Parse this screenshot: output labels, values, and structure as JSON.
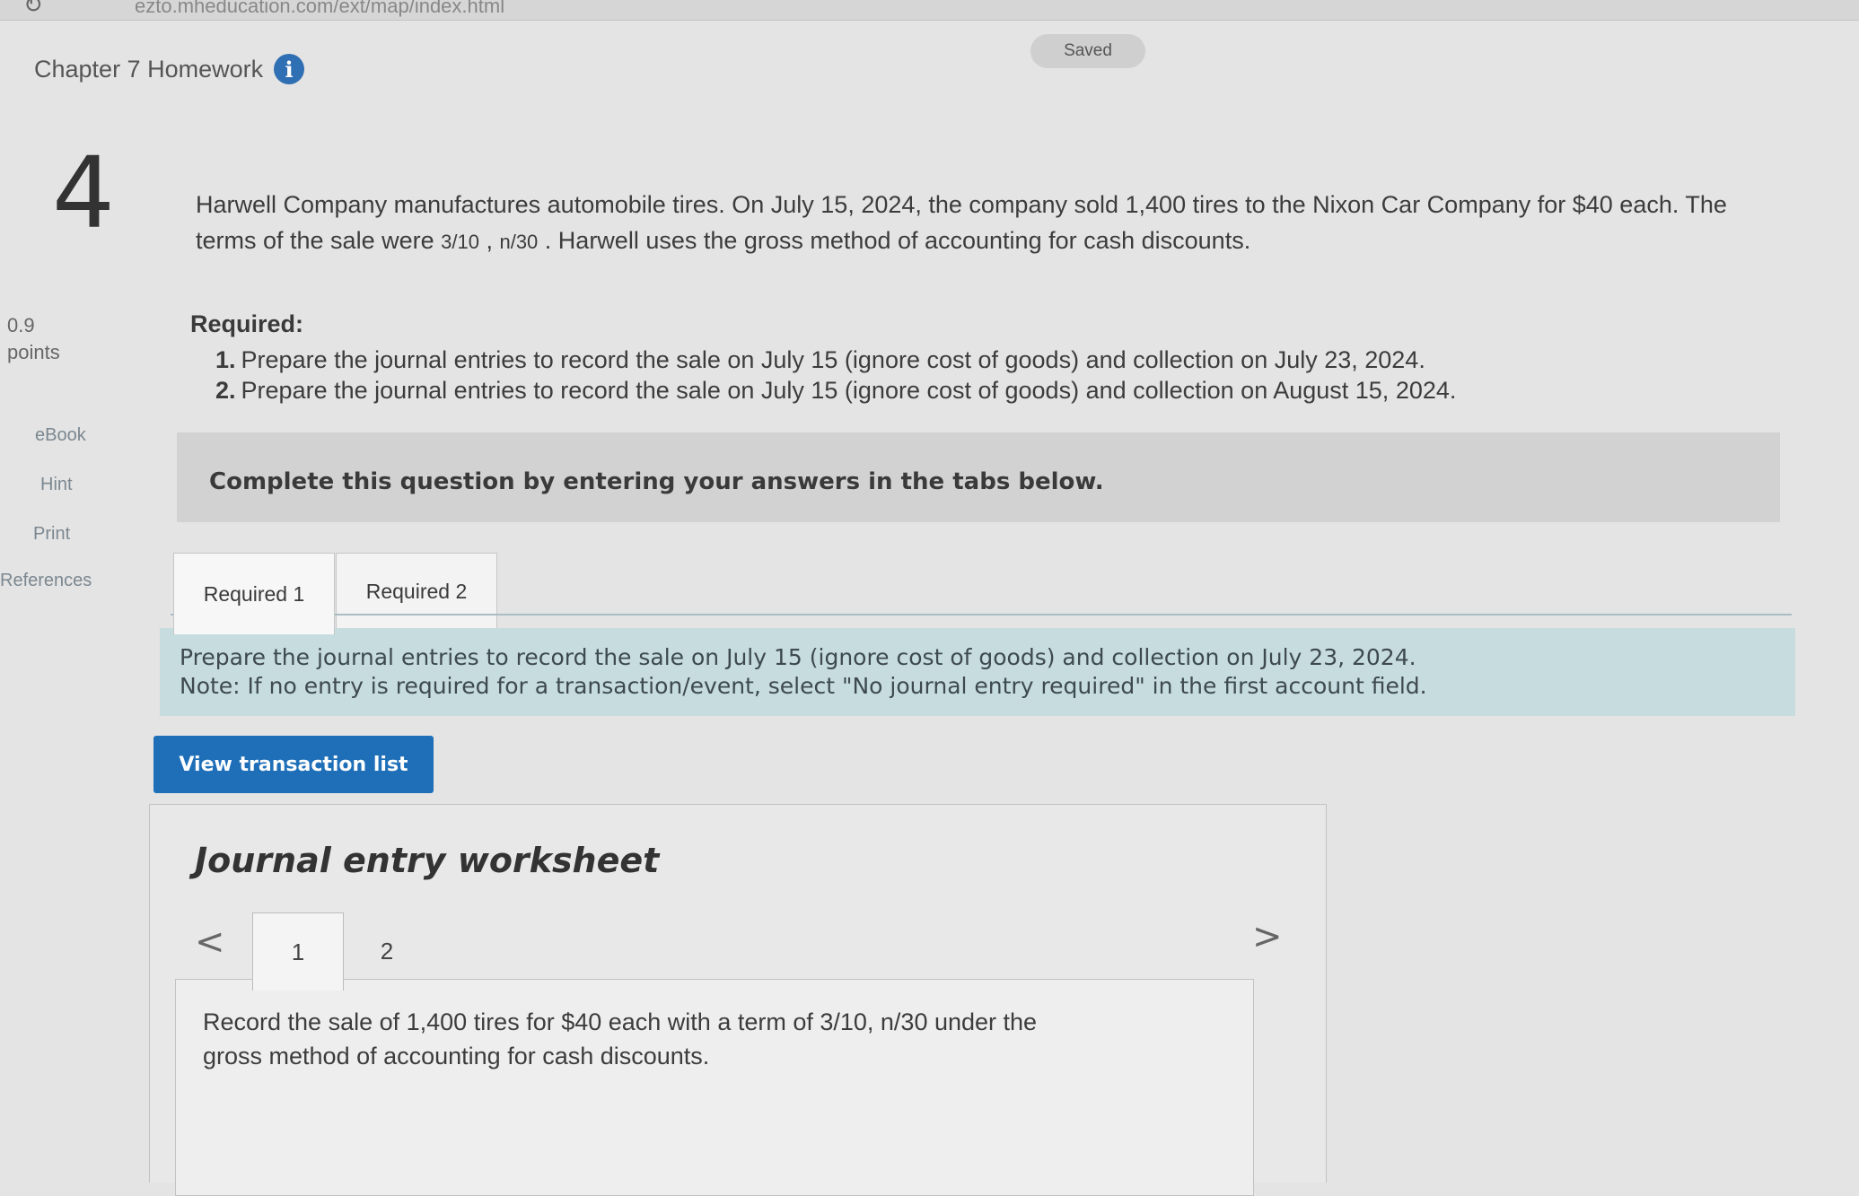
{
  "browser": {
    "url": "ezto.mheducation.com/ext/map/index.html"
  },
  "assignment": {
    "title": "Chapter 7 Homework",
    "saved_label": "Saved"
  },
  "question": {
    "number": "4",
    "points_value": "0.9",
    "points_label": "points",
    "side_links": [
      "eBook",
      "Hint",
      "Print",
      "References"
    ],
    "problem_part1": "Harwell Company manufactures automobile tires. On July 15, 2024, the company sold 1,400 tires to the Nixon Car Company for $40 each. The terms of the sale were ",
    "term1": "3/10",
    "term_sep": " , ",
    "term2": "n/30",
    "problem_part2": " . Harwell uses the gross method of accounting for cash discounts.",
    "required_heading": "Required:",
    "requirements": [
      {
        "num": "1.",
        "text": "Prepare the journal entries to record the sale on July 15 (ignore cost of goods) and collection on July 23, 2024."
      },
      {
        "num": "2.",
        "text": "Prepare the journal entries to record the sale on July 15 (ignore cost of goods) and collection on August 15, 2024."
      }
    ],
    "complete_banner": "Complete this question by entering your answers in the tabs below."
  },
  "tabs": [
    {
      "label": "Required 1"
    },
    {
      "label": "Required 2"
    }
  ],
  "instructions": {
    "line1": "Prepare the journal entries to record the sale on July 15 (ignore cost of goods) and collection on July 23, 2024.",
    "line2": "Note: If no entry is required for a transaction/event, select \"No journal entry required\" in the first account field."
  },
  "view_transaction_button": "View transaction list",
  "worksheet": {
    "title": "Journal entry worksheet",
    "prev_symbol": "<",
    "next_symbol": ">",
    "entry_tabs": [
      "1",
      "2"
    ],
    "entry_description": "Record the sale of 1,400 tires for $40 each with a term of 3/10, n/30 under the gross method of accounting for cash discounts."
  }
}
